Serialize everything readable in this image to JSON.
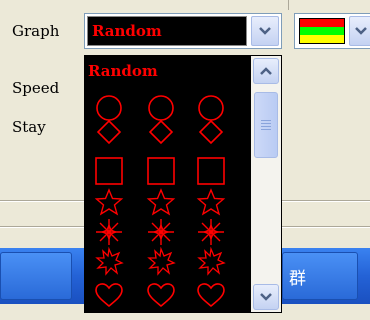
{
  "labels": {
    "graph": "Graph",
    "speed": "Speed",
    "stay": "Stay"
  },
  "graph_combo": {
    "selected": "Random",
    "arrow_icon": "chevron-down-icon"
  },
  "graph_dropdown": {
    "first_item": "Random",
    "shape_rows": [
      "circle",
      "diamond",
      "square",
      "star",
      "asterisk-star",
      "burst-star",
      "heart"
    ],
    "columns_per_row": 3,
    "shape_color": "#ff0000",
    "scroll_up_icon": "chevron-up-icon",
    "scroll_down_icon": "chevron-down-icon"
  },
  "color_combo": {
    "swatch_colors": [
      "#ff0000",
      "#00ff00",
      "#ffff00"
    ],
    "arrow_icon": "chevron-down-icon"
  },
  "taskbar": {
    "button_text": "群"
  }
}
